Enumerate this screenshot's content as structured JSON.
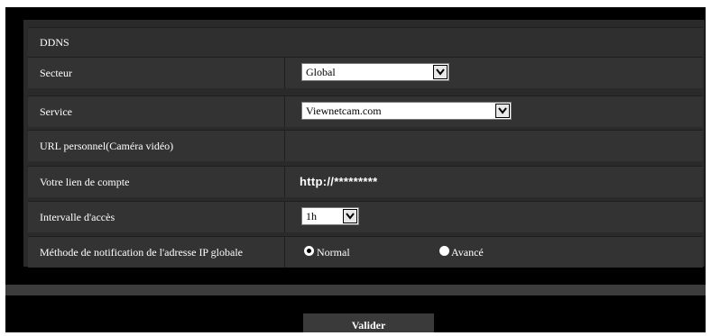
{
  "section_title": "DDNS",
  "rows": {
    "secteur": {
      "label": "Secteur",
      "value": "Global"
    },
    "service": {
      "label": "Service",
      "value": "Viewnetcam.com"
    },
    "url_perso": {
      "label": "URL personnel(Caméra vidéo)"
    },
    "lien_compte": {
      "label": "Votre lien de compte",
      "value": "http://*********"
    },
    "intervalle": {
      "label": "Intervalle d'accès",
      "value": "1h"
    },
    "methode": {
      "label": "Méthode de notification de l'adresse IP globale",
      "options": [
        "Normal",
        "Avancé"
      ],
      "selected": "Normal"
    }
  },
  "submit_label": "Valider"
}
